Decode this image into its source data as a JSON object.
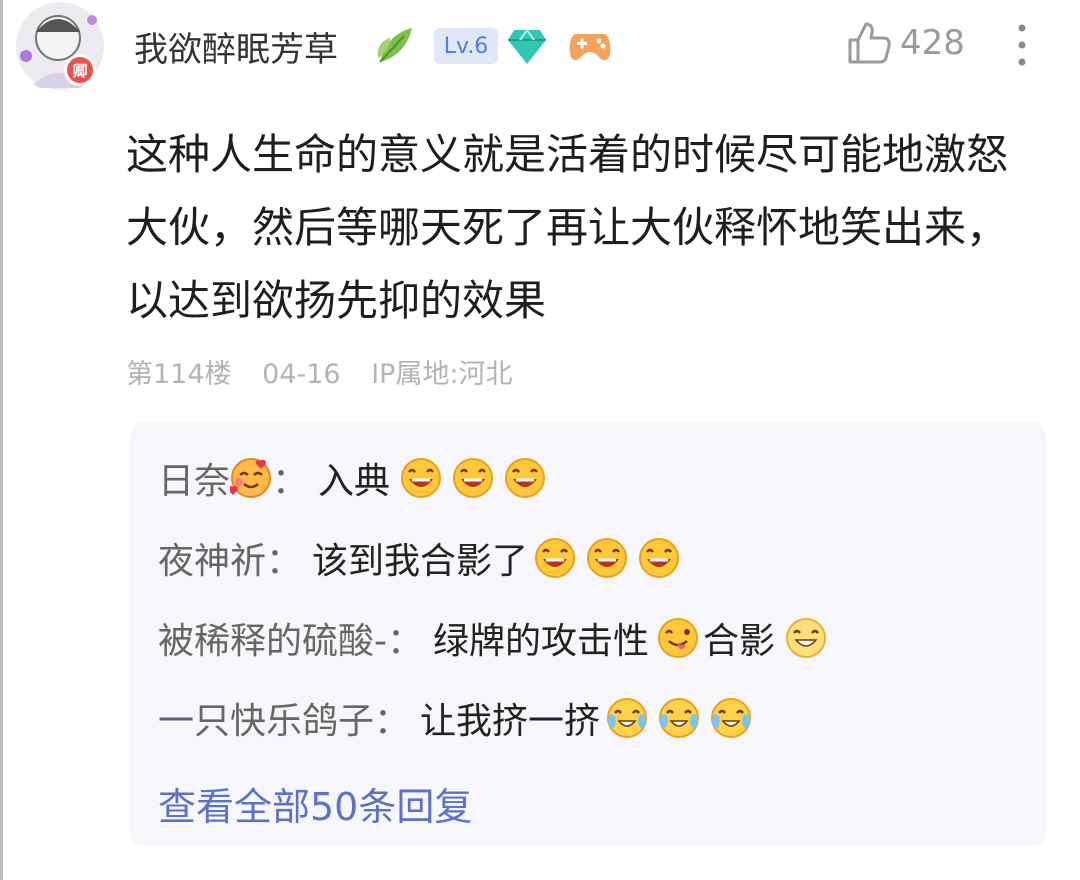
{
  "post": {
    "user": {
      "name": "我欲醉眠芳草",
      "level": "Lv.6",
      "avatar_badge": "卿"
    },
    "likes": "428",
    "content": "这种人生命的意义就是活着的时候尽可能地激怒大伙，然后等哪天死了再让大伙释怀地笑出来，以达到欲扬先抑的效果",
    "meta": {
      "floor": "第114楼",
      "date": "04-16",
      "ip": "IP属地:河北"
    }
  },
  "replies": [
    {
      "name": "日奈",
      "text": "入典",
      "name_emoji": "smiling-hearts-icon",
      "emojis": [
        "laughing-icon",
        "laughing-icon",
        "laughing-icon"
      ]
    },
    {
      "name": "夜神祈",
      "text": "该到我合影了",
      "emojis": [
        "laughing-icon",
        "laughing-icon",
        "laughing-icon"
      ]
    },
    {
      "name": "被稀释的硫酸-",
      "text_a": "绿牌的攻击性",
      "text_b": "合影",
      "emojis": [
        "tongue-wink-icon",
        "grin-icon"
      ]
    },
    {
      "name": "一只快乐鸽子",
      "text": "让我挤一挤",
      "emojis": [
        "tears-of-joy-icon",
        "tears-of-joy-icon",
        "tears-of-joy-icon"
      ]
    }
  ],
  "colon": "：",
  "view_all": "查看全部50条回复",
  "colors": {
    "link": "#5a73c6",
    "level_badge_bg": "#dfe7f8",
    "level_badge_text": "#4f7fd8",
    "reply_bg": "#f7f7fb",
    "meta_text": "#b3b3b3"
  }
}
